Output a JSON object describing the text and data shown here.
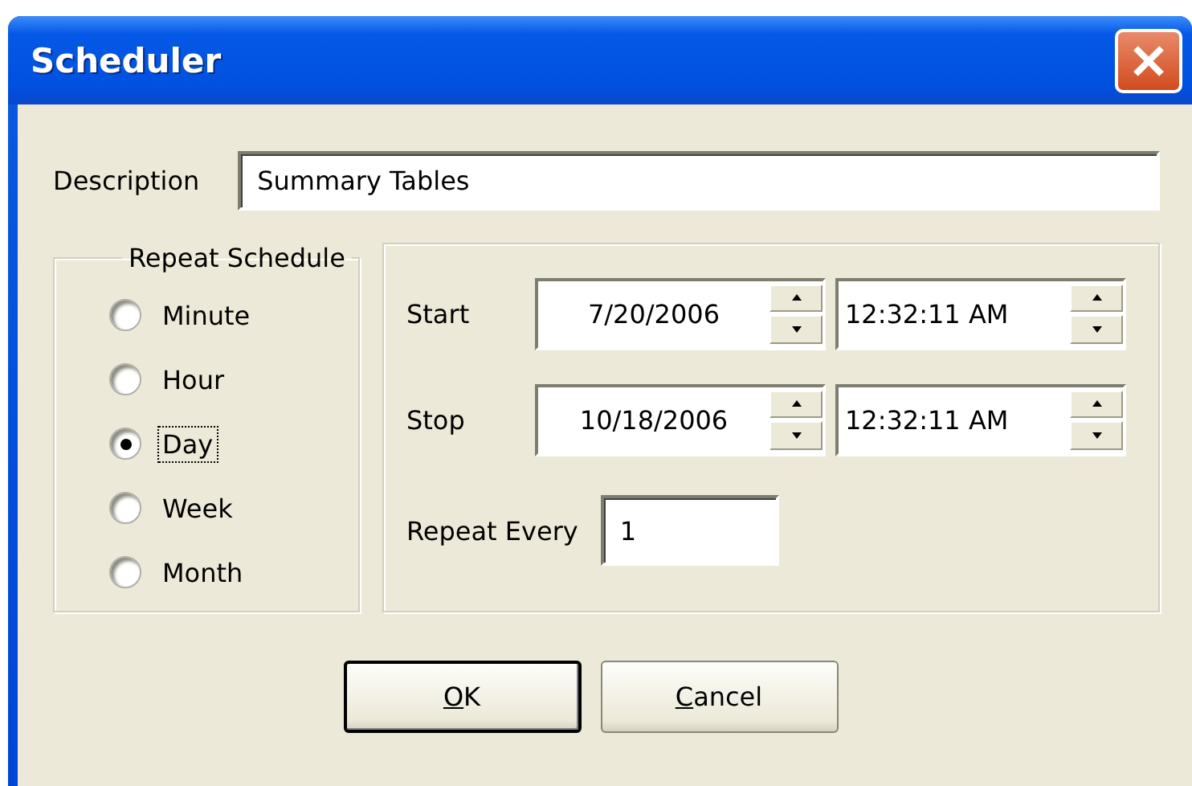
{
  "window": {
    "title": "Scheduler"
  },
  "description": {
    "label": "Description",
    "value": "Summary Tables"
  },
  "repeat_schedule": {
    "title": "Repeat Schedule",
    "options": [
      {
        "label": "Minute",
        "selected": false,
        "focused": false
      },
      {
        "label": "Hour",
        "selected": false,
        "focused": false
      },
      {
        "label": "Day",
        "selected": true,
        "focused": true
      },
      {
        "label": "Week",
        "selected": false,
        "focused": false
      },
      {
        "label": "Month",
        "selected": false,
        "focused": false
      }
    ]
  },
  "range": {
    "rows": [
      {
        "label": "Start",
        "date": "7/20/2006",
        "time": "12:32:11 AM"
      },
      {
        "label": "Stop",
        "date": "10/18/2006",
        "time": "12:32:11 AM"
      }
    ],
    "repeat_every": {
      "label": "Repeat Every",
      "value": "1"
    }
  },
  "buttons": [
    {
      "label": "OK",
      "default": true,
      "underline_first": true
    },
    {
      "label": "Cancel",
      "default": false,
      "underline_first": true
    }
  ]
}
